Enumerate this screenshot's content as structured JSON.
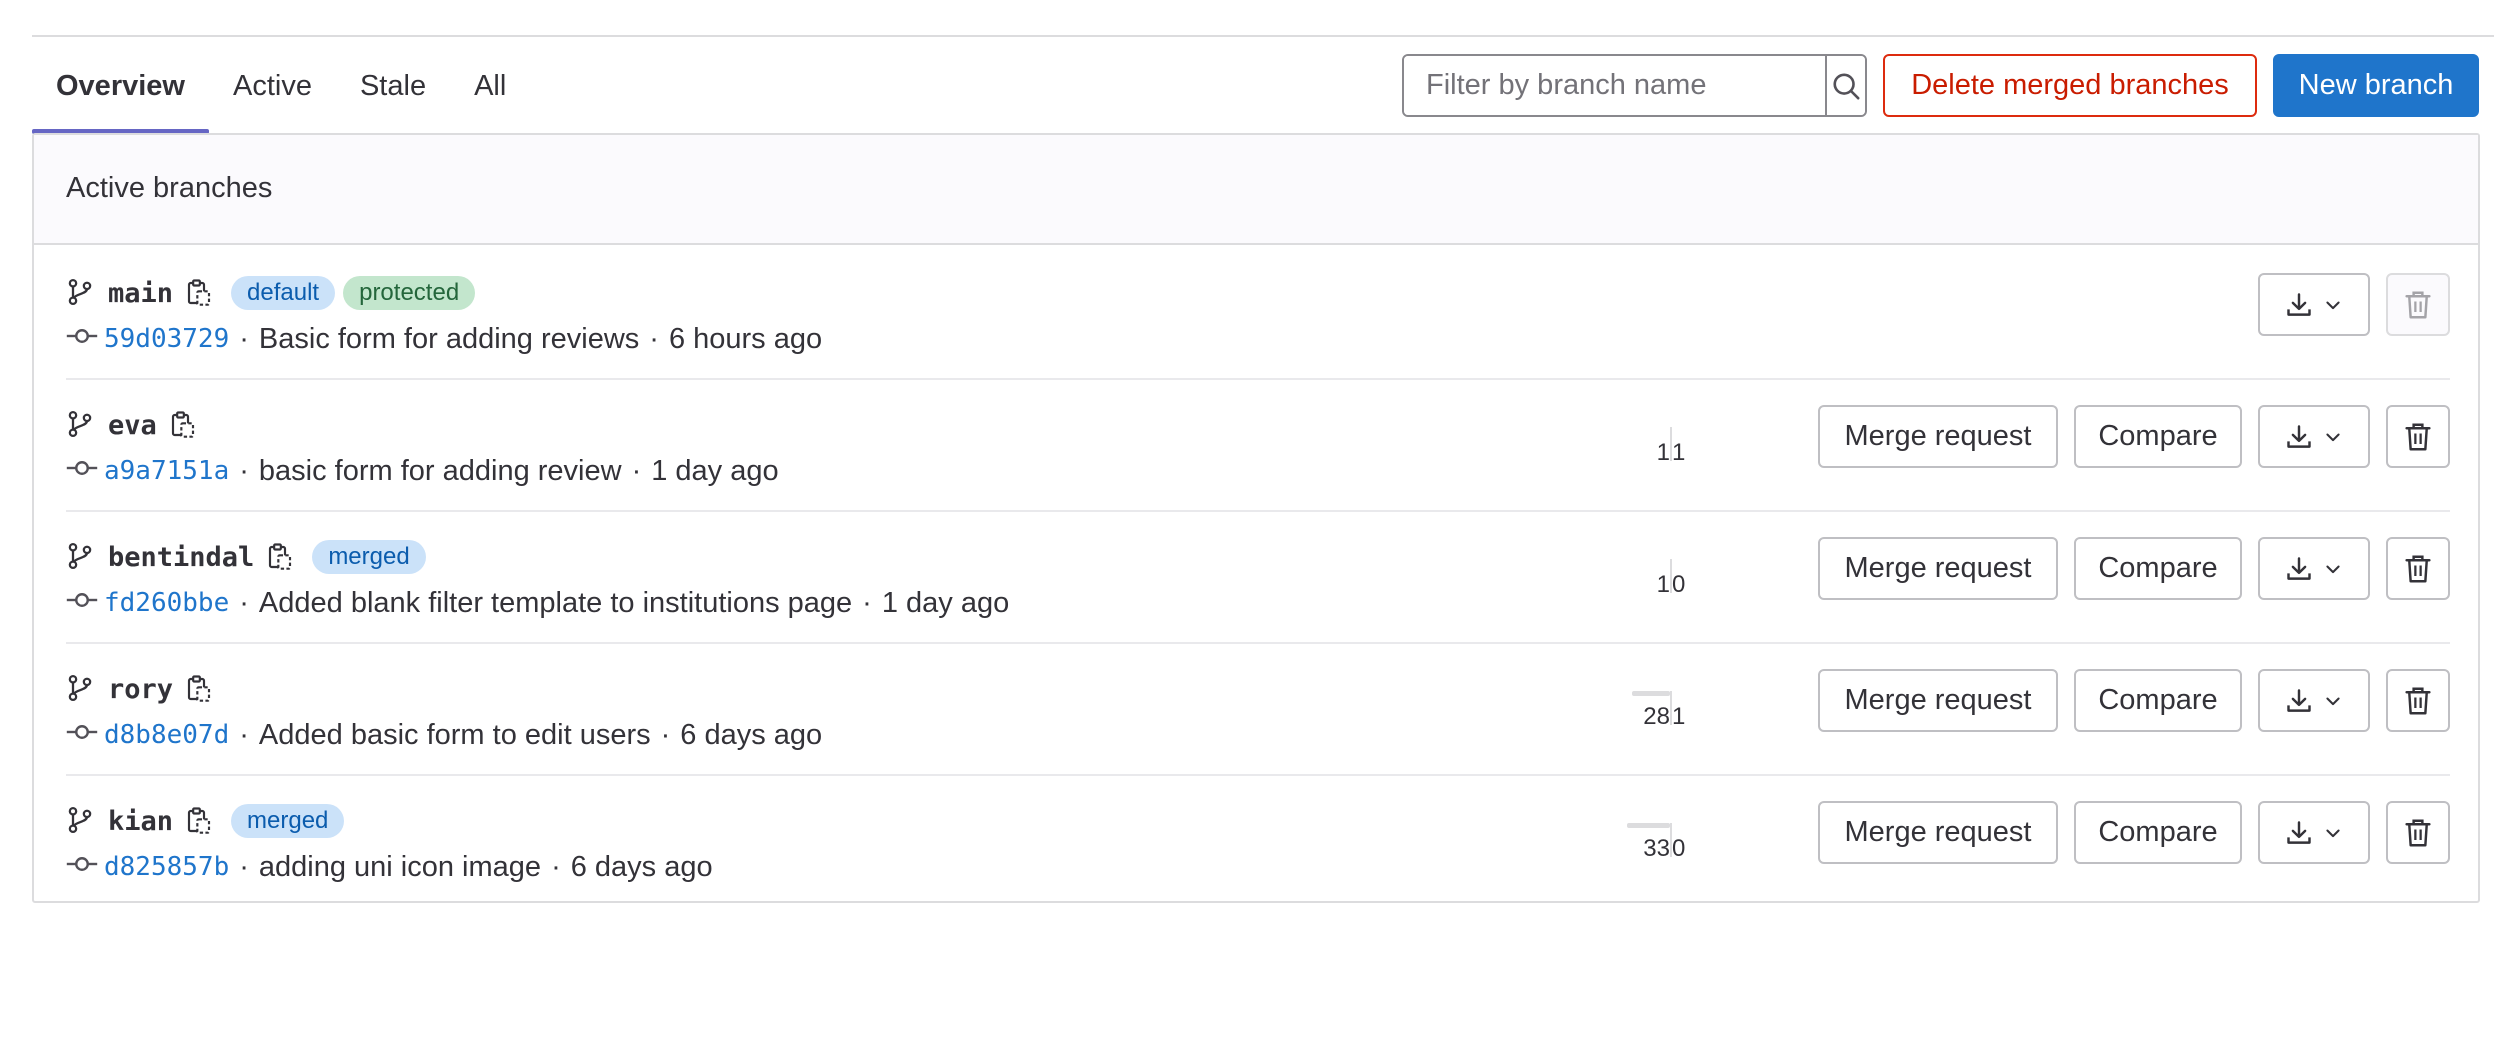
{
  "tabs": [
    {
      "label": "Overview",
      "active": true
    },
    {
      "label": "Active",
      "active": false
    },
    {
      "label": "Stale",
      "active": false
    },
    {
      "label": "All",
      "active": false
    }
  ],
  "filter": {
    "placeholder": "Filter by branch name",
    "icon": "search-icon"
  },
  "buttons": {
    "delete_merged": "Delete merged branches",
    "new_branch": "New branch",
    "merge_request": "Merge request",
    "compare": "Compare"
  },
  "section_title": "Active branches",
  "colors": {
    "primary": "#1f75cb",
    "danger": "#dd2b0e",
    "active_tab_underline": "#6666c4",
    "badge_blue_bg": "#cbe2f9",
    "badge_green_bg": "#c3e6cd"
  },
  "branches": [
    {
      "name": "main",
      "badges": [
        {
          "label": "default",
          "variant": "blue"
        },
        {
          "label": "protected",
          "variant": "green"
        }
      ],
      "sha": "59d03729",
      "message": "Basic form for adding reviews",
      "time": "6 hours ago",
      "behind": "",
      "ahead": "",
      "show_mr": false,
      "delete_disabled": true
    },
    {
      "name": "eva",
      "badges": [],
      "sha": "a9a7151a",
      "message": "basic form for adding review",
      "time": "1 day ago",
      "behind": "1",
      "ahead": "1",
      "show_mr": true,
      "delete_disabled": false
    },
    {
      "name": "bentindal",
      "badges": [
        {
          "label": "merged",
          "variant": "blue"
        }
      ],
      "sha": "fd260bbe",
      "message": "Added blank filter template to institutions page",
      "time": "1 day ago",
      "behind": "1",
      "ahead": "0",
      "show_mr": true,
      "delete_disabled": false
    },
    {
      "name": "rory",
      "badges": [],
      "sha": "d8b8e07d",
      "message": "Added basic form to edit users",
      "time": "6 days ago",
      "behind": "28",
      "ahead": "1",
      "show_mr": true,
      "delete_disabled": false
    },
    {
      "name": "kian",
      "badges": [
        {
          "label": "merged",
          "variant": "blue"
        }
      ],
      "sha": "d825857b",
      "message": "adding uni icon image",
      "time": "6 days ago",
      "behind": "33",
      "ahead": "0",
      "show_mr": true,
      "delete_disabled": false
    }
  ]
}
